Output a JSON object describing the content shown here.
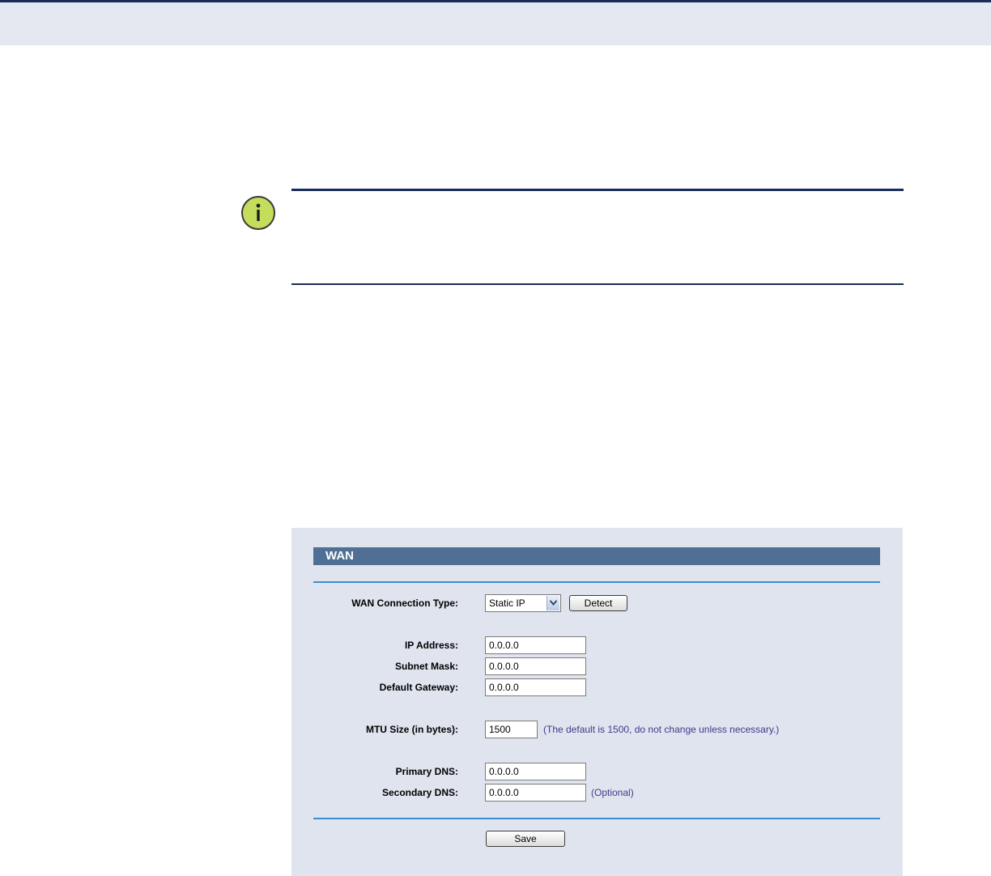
{
  "note": {
    "icon": "info-icon"
  },
  "wan": {
    "title": "WAN",
    "connection_type": {
      "label": "WAN Connection Type:",
      "selected": "Static IP",
      "detect_label": "Detect"
    },
    "ip_address": {
      "label": "IP Address:",
      "value": "0.0.0.0"
    },
    "subnet_mask": {
      "label": "Subnet Mask:",
      "value": "0.0.0.0"
    },
    "default_gateway": {
      "label": "Default Gateway:",
      "value": "0.0.0.0"
    },
    "mtu": {
      "label": "MTU Size (in bytes):",
      "value": "1500",
      "hint": "(The default is 1500, do not change unless necessary.)"
    },
    "primary_dns": {
      "label": "Primary DNS:",
      "value": "0.0.0.0"
    },
    "secondary_dns": {
      "label": "Secondary DNS:",
      "value": "0.0.0.0",
      "hint": "(Optional)"
    },
    "save_label": "Save"
  },
  "colors": {
    "header_band": "#e5e8f0",
    "navy_rule": "#1a2c5a",
    "panel_bg": "#dfe4ee",
    "panel_title_bg": "#4f7094",
    "panel_rule": "#3b8fd1",
    "info_icon_fill": "#c4dd5a"
  }
}
